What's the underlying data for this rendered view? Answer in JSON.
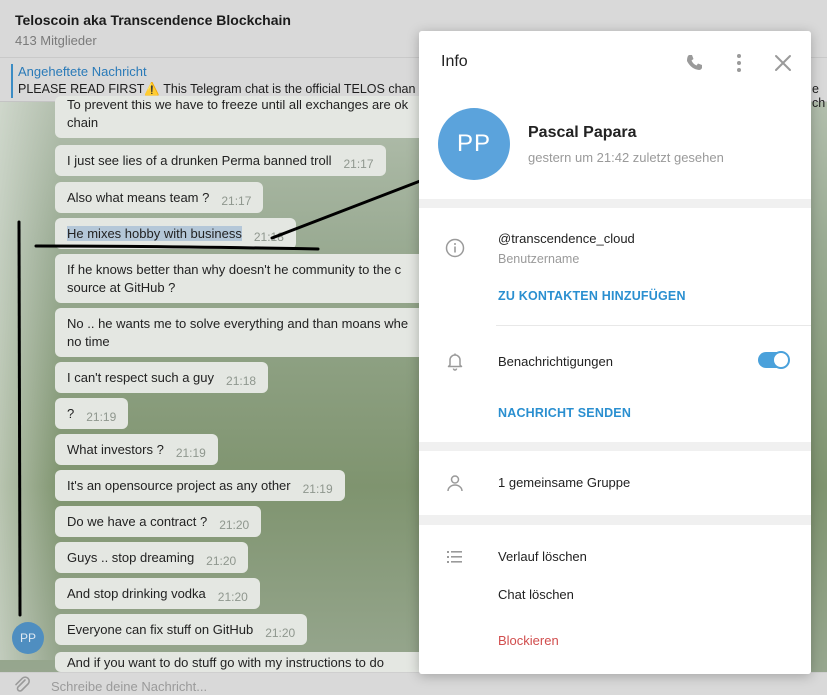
{
  "chat": {
    "title": "Teloscoin aka Transcendence Blockchain",
    "members": "413 Mitglieder",
    "pinned_title": "Angeheftete Nachricht",
    "pinned_text": "PLEASE READ FIRST⚠️  This Telegram chat is the official TELOS chan",
    "pinned_tail": "e ch",
    "avatar_initials": "PP",
    "composer_placeholder": "Schreibe deine Nachricht..."
  },
  "messages": [
    {
      "text": "To prevent this we have to freeze until all exchanges are ok",
      "text2": "chain",
      "time": ""
    },
    {
      "text": "I just see lies of a drunken Perma banned troll",
      "time": "21:17"
    },
    {
      "text": "Also what means team ?",
      "time": "21:17"
    },
    {
      "text": "He mixes hobby with business",
      "time": "21:18"
    },
    {
      "text": "If he knows better than why doesn't he community to the c",
      "text2": "source at GitHub ?",
      "time": ""
    },
    {
      "text": "No .. he wants me to solve everything and than moans whe",
      "text2": "no time",
      "time": ""
    },
    {
      "text": "I can't respect such a guy",
      "time": "21:18"
    },
    {
      "text": "?",
      "time": "21:19"
    },
    {
      "text": "What investors ?",
      "time": "21:19"
    },
    {
      "text": "It's an opensource project as any other",
      "time": "21:19"
    },
    {
      "text": "Do we have a contract ?",
      "time": "21:20"
    },
    {
      "text": "Guys .. stop dreaming",
      "time": "21:20"
    },
    {
      "text": "And stop drinking vodka",
      "time": "21:20"
    },
    {
      "text": "Everyone can fix stuff on GitHub",
      "time": "21:20"
    },
    {
      "text": "And if you want to do stuff go with my instructions to do",
      "time": ""
    }
  ],
  "info": {
    "title": "Info",
    "avatar_initials": "PP",
    "name": "Pascal Papara",
    "last_seen": "gestern um 21:42 zuletzt gesehen",
    "username": "@transcendence_cloud",
    "username_label": "Benutzername",
    "add_contact": "ZU KONTAKTEN HINZUFÜGEN",
    "notifications_label": "Benachrichtigungen",
    "notifications_on": true,
    "send_message": "NACHRICHT SENDEN",
    "common_groups": "1 gemeinsame Gruppe",
    "clear_history": "Verlauf löschen",
    "delete_chat": "Chat löschen",
    "block": "Blockieren"
  },
  "colors": {
    "accent": "#2a8fd0",
    "avatar": "#5ba3dc",
    "danger": "#d14d4d",
    "toggle": "#4aa1db"
  }
}
